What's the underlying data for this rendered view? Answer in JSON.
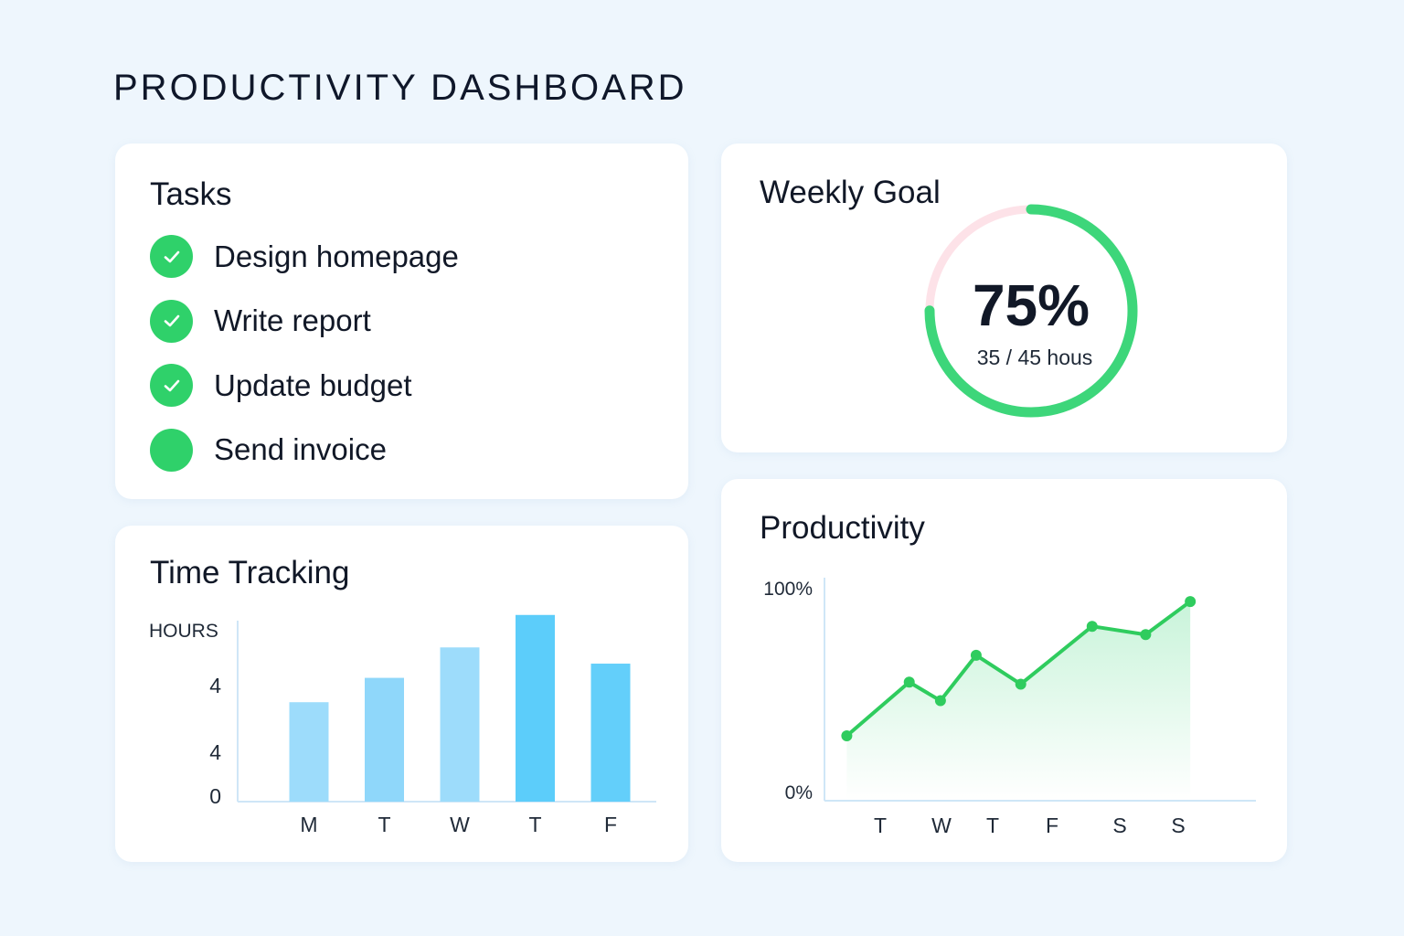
{
  "page": {
    "title": "PRODUCTIVITY DASHBOARD"
  },
  "tasks": {
    "title": "Tasks",
    "items": [
      {
        "label": "Design homepage",
        "done": true
      },
      {
        "label": "Write report",
        "done": true
      },
      {
        "label": "Update budget",
        "done": true
      },
      {
        "label": "Send invoice",
        "done": false
      }
    ]
  },
  "weekly_goal": {
    "title": "Weekly Goal",
    "percent_label": "75%",
    "hours_label": "35 / 45 hous",
    "progress": 0.75,
    "colors": {
      "progress": "#3dd67a",
      "track": "#fde2e8"
    }
  },
  "time_tracking": {
    "title": "Time Tracking"
  },
  "productivity": {
    "title": "Productivity"
  },
  "chart_data": [
    {
      "type": "bar",
      "ylabel": "HOURS",
      "ytick_labels": [
        "4",
        "4",
        "0"
      ],
      "categories": [
        "M",
        "T",
        "W",
        "T",
        "F"
      ],
      "values": [
        4.9,
        6.1,
        7.6,
        9.2,
        6.8
      ],
      "ylim": [
        0,
        10
      ],
      "colors": [
        "#9ddcfb",
        "#8fd7fa",
        "#9ddcfb",
        "#5ccdfa",
        "#63cffa"
      ]
    },
    {
      "type": "line",
      "ytick_labels": [
        "100%",
        "0%"
      ],
      "xtick_labels": [
        "T",
        "W",
        "T",
        "F",
        "S",
        "S"
      ],
      "x": [
        0.5,
        1.9,
        2.6,
        3.4,
        4.4,
        6.0,
        7.2,
        8.2
      ],
      "values": [
        27,
        53,
        44,
        66,
        52,
        80,
        76,
        92
      ],
      "ylim": [
        0,
        100
      ],
      "color": "#2fcc5e",
      "area_fill": true
    }
  ]
}
